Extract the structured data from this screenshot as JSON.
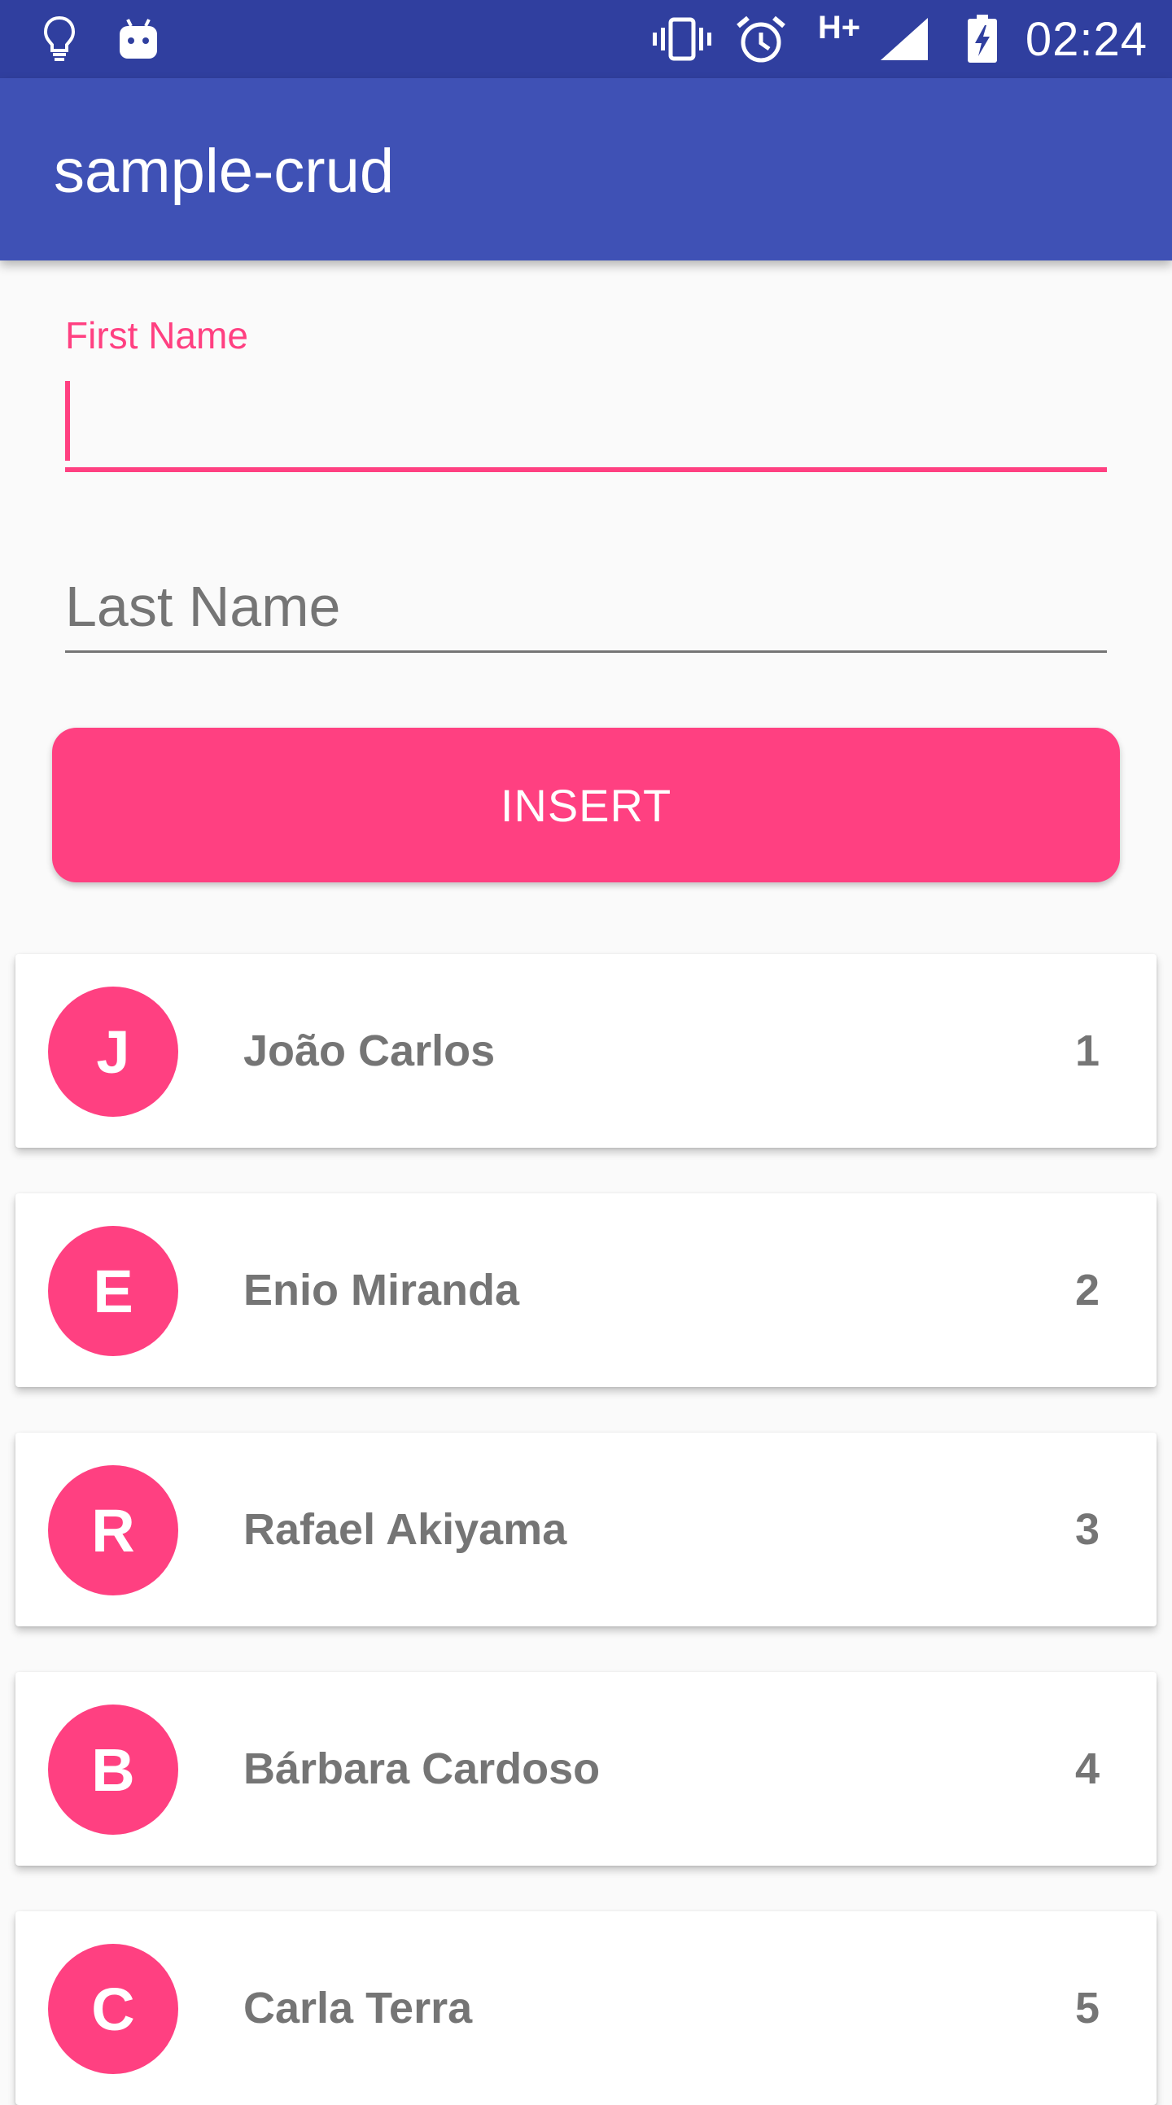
{
  "status_bar": {
    "time": "02:24",
    "network_label": "H+",
    "icons": [
      "lightbulb-icon",
      "android-icon",
      "vibrate-icon",
      "alarm-icon",
      "signal-icon",
      "battery-charging-icon"
    ]
  },
  "app_bar": {
    "title": "sample-crud"
  },
  "form": {
    "first_name_label": "First Name",
    "first_name_value": "",
    "last_name_placeholder": "Last Name",
    "last_name_value": "",
    "insert_label": "INSERT"
  },
  "colors": {
    "primary_dark": "#303F9F",
    "primary": "#3F51B5",
    "accent": "#FF4081",
    "background": "#FAFAFA",
    "secondary_text": "#757575"
  },
  "people": [
    {
      "initial": "J",
      "name": "João Carlos",
      "id": "1"
    },
    {
      "initial": "E",
      "name": "Enio Miranda",
      "id": "2"
    },
    {
      "initial": "R",
      "name": "Rafael Akiyama",
      "id": "3"
    },
    {
      "initial": "B",
      "name": "Bárbara Cardoso",
      "id": "4"
    },
    {
      "initial": "C",
      "name": "Carla Terra",
      "id": "5"
    }
  ]
}
